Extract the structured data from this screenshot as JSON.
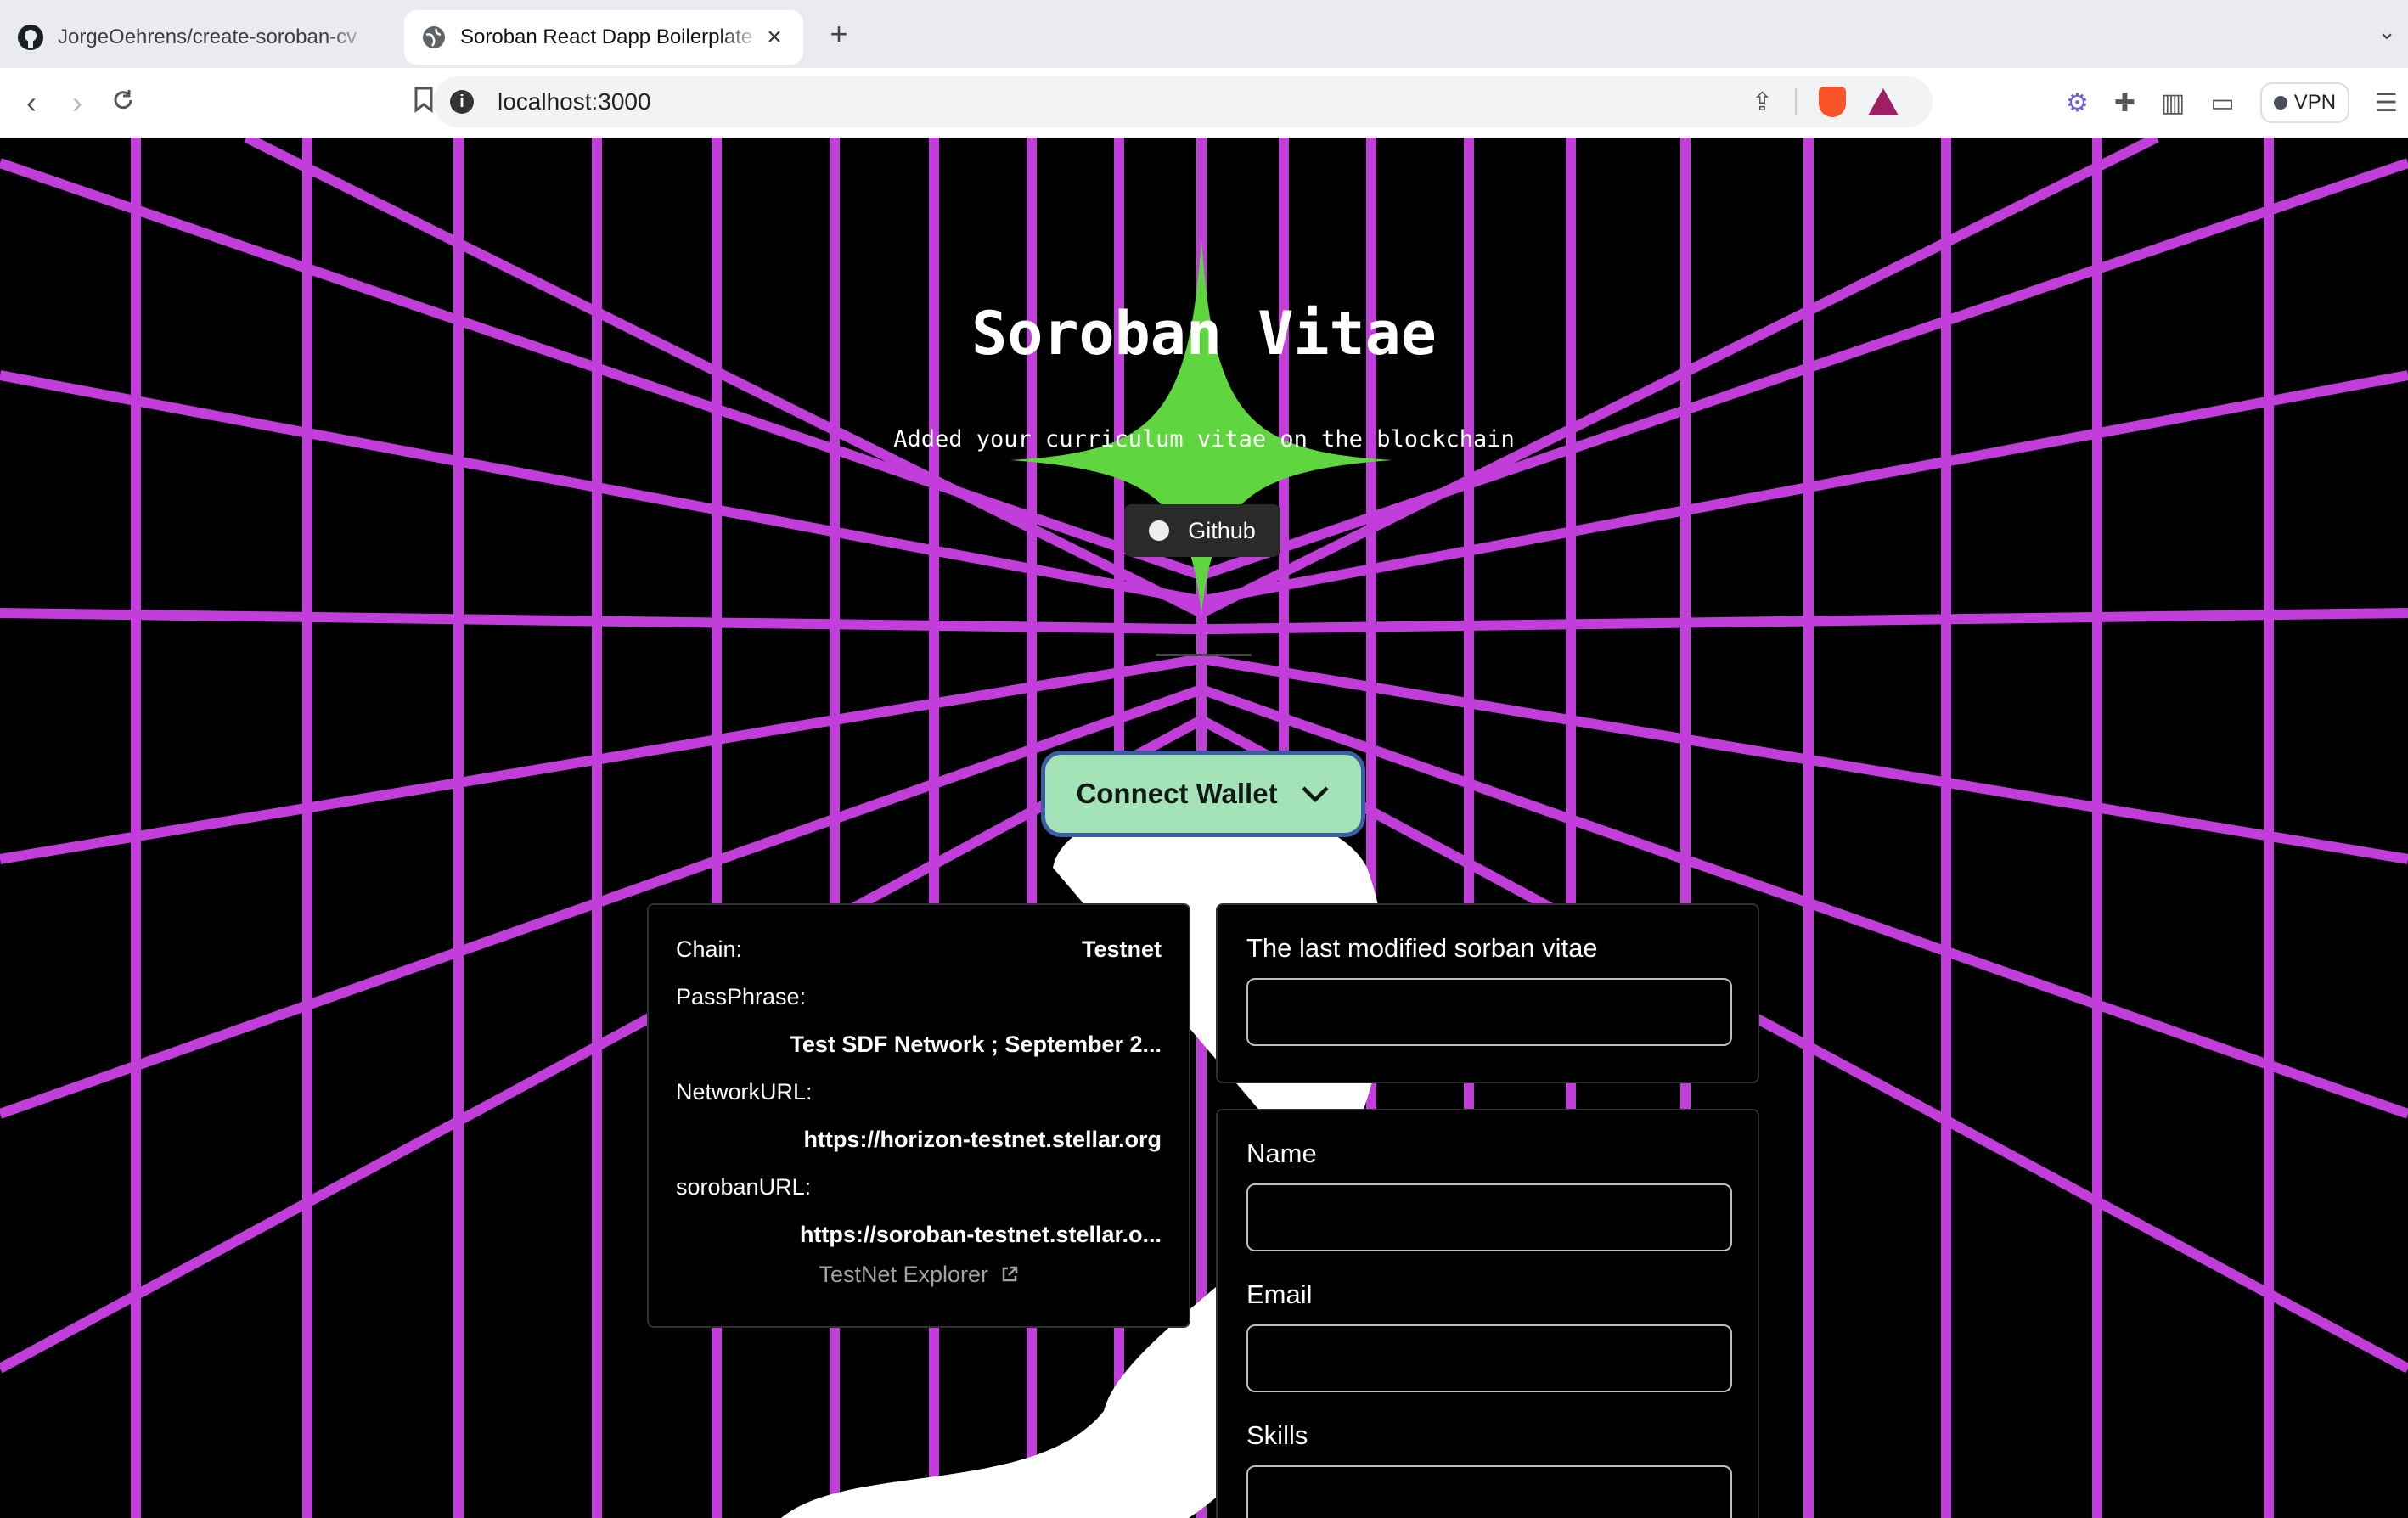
{
  "browser": {
    "tabs": [
      {
        "title": "JorgeOehrens/create-soroban-cv",
        "active": false
      },
      {
        "title": "Soroban React Dapp Boilerplate",
        "active": true
      }
    ],
    "new_tab": "+",
    "url": "localhost:3000",
    "vpn_label": "VPN"
  },
  "hero": {
    "title": "Soroban Vitae",
    "subtitle": "Added your curriculum vitae on the blockchain",
    "github_label": "Github",
    "star_color": "#5fd63f",
    "grid_color": "#c23edb"
  },
  "wallet": {
    "connect_label": "Connect Wallet",
    "button_color": "#a3e3b7"
  },
  "network": {
    "chain_label": "Chain:",
    "chain_value": "Testnet",
    "passphrase_label": "PassPhrase:",
    "passphrase_value": "Test SDF Network ; September 2...",
    "network_url_label": "NetworkURL:",
    "network_url_value": "https://horizon-testnet.stellar.org",
    "soroban_url_label": "sorobanURL:",
    "soroban_url_value": "https://soroban-testnet.stellar.o...",
    "explorer_label": "TestNet Explorer"
  },
  "vitae": {
    "last_modified_label": "The last modified sorban vitae",
    "last_modified_value": ""
  },
  "form": {
    "name_label": "Name",
    "name_value": "",
    "email_label": "Email",
    "email_value": "",
    "skills_label": "Skills",
    "skills_value": ""
  }
}
